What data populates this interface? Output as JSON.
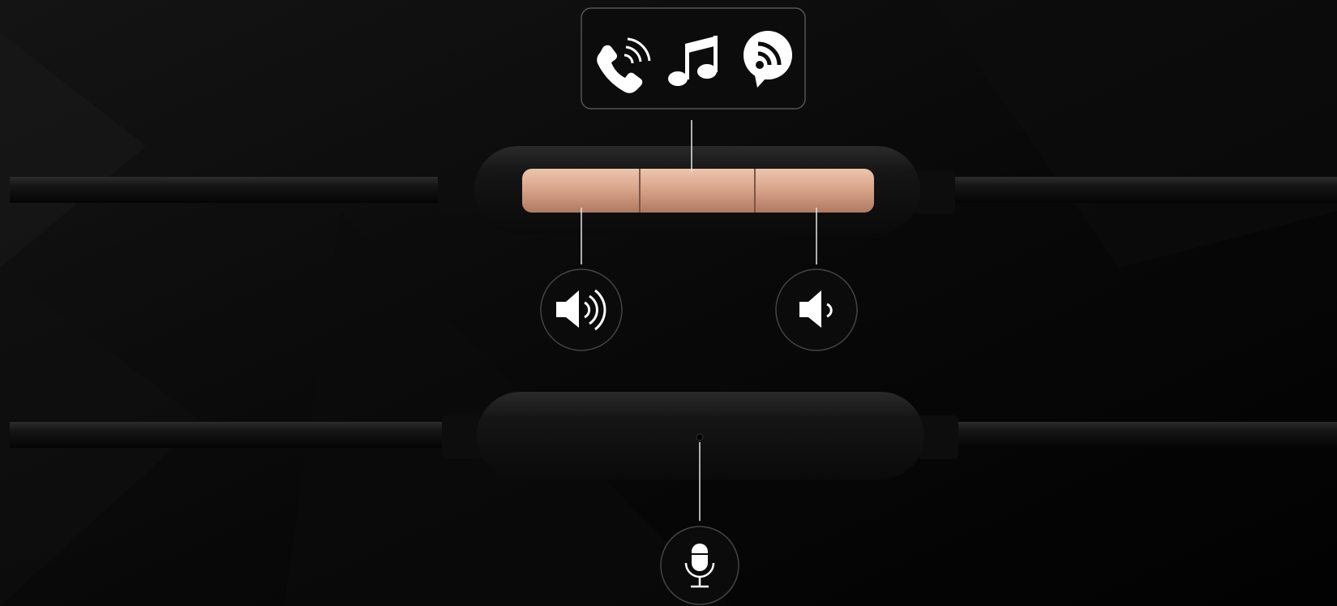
{
  "scene": {
    "background": "#070707",
    "accent": "#d39e86",
    "line_color": "#e6e6e6"
  },
  "controls": {
    "center_button": {
      "icons": [
        "phone-call-icon",
        "music-note-icon",
        "podcast-feed-icon"
      ]
    },
    "volume_up": {
      "icon": "volume-up-icon"
    },
    "volume_down": {
      "icon": "volume-down-icon"
    },
    "microphone": {
      "icon": "microphone-icon"
    }
  }
}
